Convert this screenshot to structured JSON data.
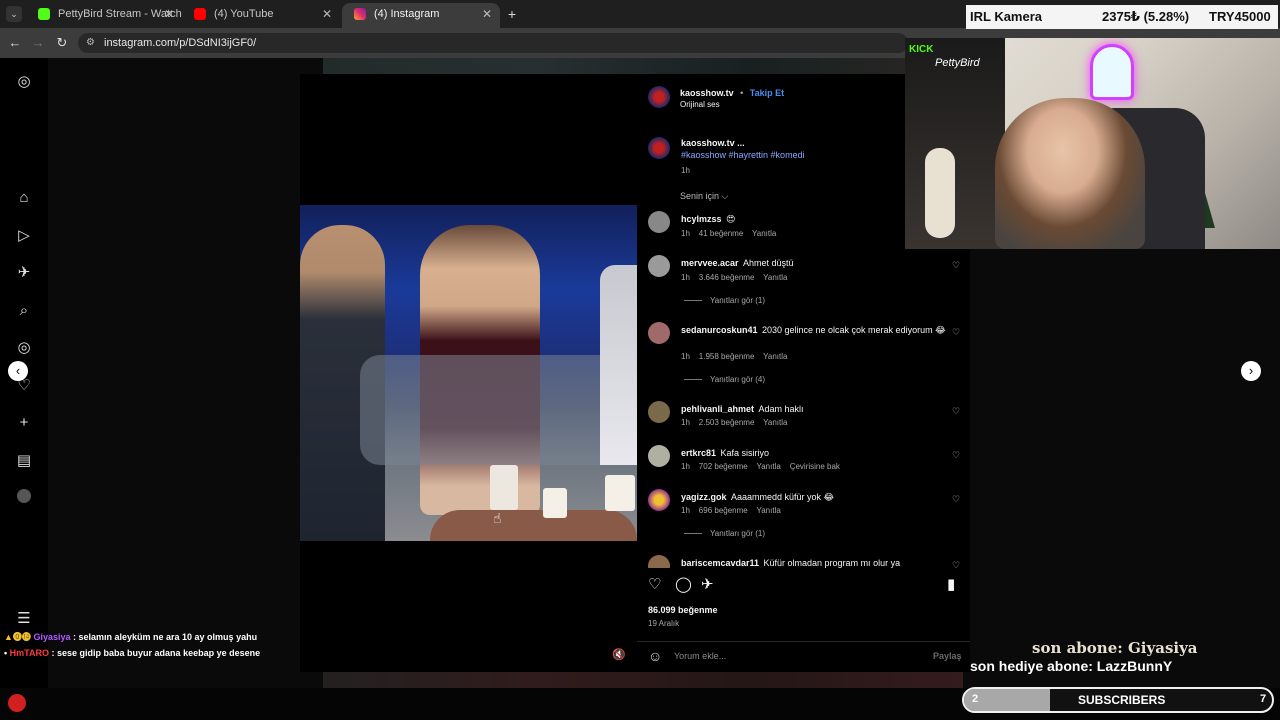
{
  "browser": {
    "tabs": [
      {
        "label": "PettyBird Stream - Watch Live o",
        "favicon_color": "#53fc18"
      },
      {
        "label": "(4) YouTube",
        "favicon_color": "#ff0000"
      },
      {
        "label": "(4) Instagram",
        "favicon_color": "#e1306c"
      }
    ],
    "url": "instagram.com/p/DSdNI3ijGF0/"
  },
  "post": {
    "author": "kaosshow.tv",
    "separator": "•",
    "follow_label": "Takip Et",
    "audio": "Orijinal ses",
    "caption_author": "kaosshow.tv ...",
    "hashtags": "#kaosshow #hayrettin #komedi",
    "caption_time": "1h",
    "sort_label": "Senin için ⌵",
    "likes": "86.099 beğenme",
    "date": "19 Aralık",
    "comment_placeholder": "Yorum ekle...",
    "share_label": "Paylaş"
  },
  "comments": [
    {
      "user": "hcylmzss",
      "text": "😍",
      "time": "1h",
      "likes": "41 beğenme",
      "reply": "Yanıtla"
    },
    {
      "user": "mervvee.acar",
      "text": "Ahmet düştü",
      "time": "1h",
      "likes": "3.646 beğenme",
      "reply": "Yanıtla",
      "replies": "Yanıtları gör (1)"
    },
    {
      "user": "sedanurcoskun41",
      "text": "2030 gelince ne olcak çok merak ediyorum 😂",
      "time": "1h",
      "likes": "1.958 beğenme",
      "reply": "Yanıtla",
      "replies": "Yanıtları gör (4)"
    },
    {
      "user": "pehlivanli_ahmet",
      "text": "Adam haklı",
      "time": "1h",
      "likes": "2.503 beğenme",
      "reply": "Yanıtla"
    },
    {
      "user": "ertkrc81",
      "text": "Kafa sisiriyo",
      "time": "1h",
      "likes": "702 beğenme",
      "reply": "Yanıtla",
      "translate": "Çevirisine bak"
    },
    {
      "user": "yagizz.gok",
      "text": "Aaaammedd küfür yok 😂",
      "time": "1h",
      "likes": "696 beğenme",
      "reply": "Yanıtla",
      "replies": "Yanıtları gör (1)"
    },
    {
      "user": "bariscemcavdar11",
      "text": "Küfür olmadan program mı olur ya"
    }
  ],
  "overlay": {
    "ticker_label": "IRL Kamera",
    "ticker_value": "2375₺ (5.28%)",
    "ticker_goal": "TRY45000",
    "cam_brand": "KICK",
    "cam_name": "PettyBird",
    "chat": [
      {
        "user": "Giyasiya",
        "text": ": selamın aleyküm ne ara 10 ay olmuş yahu",
        "color": "#b05cff"
      },
      {
        "user": "HmTARO",
        "text": ": sese gidip baba buyur adana keebap ye desene",
        "color": "#ff3b3b"
      }
    ],
    "last_sub": "son abone: Giyasiya",
    "last_gift": "son hediye abone: LazzBunnY",
    "sub_current": "2",
    "sub_label": "SUBSCRIBERS",
    "sub_goal": "7",
    "sub_progress": 0.28
  }
}
